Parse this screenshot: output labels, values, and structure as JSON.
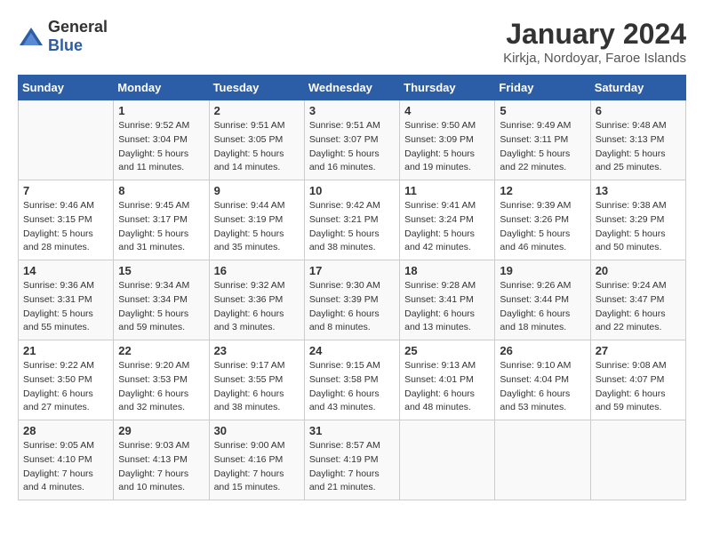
{
  "logo": {
    "general": "General",
    "blue": "Blue"
  },
  "title": "January 2024",
  "location": "Kirkja, Nordoyar, Faroe Islands",
  "weekdays": [
    "Sunday",
    "Monday",
    "Tuesday",
    "Wednesday",
    "Thursday",
    "Friday",
    "Saturday"
  ],
  "weeks": [
    [
      {
        "day": "",
        "sunrise": "",
        "sunset": "",
        "daylight": ""
      },
      {
        "day": "1",
        "sunrise": "Sunrise: 9:52 AM",
        "sunset": "Sunset: 3:04 PM",
        "daylight": "Daylight: 5 hours and 11 minutes."
      },
      {
        "day": "2",
        "sunrise": "Sunrise: 9:51 AM",
        "sunset": "Sunset: 3:05 PM",
        "daylight": "Daylight: 5 hours and 14 minutes."
      },
      {
        "day": "3",
        "sunrise": "Sunrise: 9:51 AM",
        "sunset": "Sunset: 3:07 PM",
        "daylight": "Daylight: 5 hours and 16 minutes."
      },
      {
        "day": "4",
        "sunrise": "Sunrise: 9:50 AM",
        "sunset": "Sunset: 3:09 PM",
        "daylight": "Daylight: 5 hours and 19 minutes."
      },
      {
        "day": "5",
        "sunrise": "Sunrise: 9:49 AM",
        "sunset": "Sunset: 3:11 PM",
        "daylight": "Daylight: 5 hours and 22 minutes."
      },
      {
        "day": "6",
        "sunrise": "Sunrise: 9:48 AM",
        "sunset": "Sunset: 3:13 PM",
        "daylight": "Daylight: 5 hours and 25 minutes."
      }
    ],
    [
      {
        "day": "7",
        "sunrise": "Sunrise: 9:46 AM",
        "sunset": "Sunset: 3:15 PM",
        "daylight": "Daylight: 5 hours and 28 minutes."
      },
      {
        "day": "8",
        "sunrise": "Sunrise: 9:45 AM",
        "sunset": "Sunset: 3:17 PM",
        "daylight": "Daylight: 5 hours and 31 minutes."
      },
      {
        "day": "9",
        "sunrise": "Sunrise: 9:44 AM",
        "sunset": "Sunset: 3:19 PM",
        "daylight": "Daylight: 5 hours and 35 minutes."
      },
      {
        "day": "10",
        "sunrise": "Sunrise: 9:42 AM",
        "sunset": "Sunset: 3:21 PM",
        "daylight": "Daylight: 5 hours and 38 minutes."
      },
      {
        "day": "11",
        "sunrise": "Sunrise: 9:41 AM",
        "sunset": "Sunset: 3:24 PM",
        "daylight": "Daylight: 5 hours and 42 minutes."
      },
      {
        "day": "12",
        "sunrise": "Sunrise: 9:39 AM",
        "sunset": "Sunset: 3:26 PM",
        "daylight": "Daylight: 5 hours and 46 minutes."
      },
      {
        "day": "13",
        "sunrise": "Sunrise: 9:38 AM",
        "sunset": "Sunset: 3:29 PM",
        "daylight": "Daylight: 5 hours and 50 minutes."
      }
    ],
    [
      {
        "day": "14",
        "sunrise": "Sunrise: 9:36 AM",
        "sunset": "Sunset: 3:31 PM",
        "daylight": "Daylight: 5 hours and 55 minutes."
      },
      {
        "day": "15",
        "sunrise": "Sunrise: 9:34 AM",
        "sunset": "Sunset: 3:34 PM",
        "daylight": "Daylight: 5 hours and 59 minutes."
      },
      {
        "day": "16",
        "sunrise": "Sunrise: 9:32 AM",
        "sunset": "Sunset: 3:36 PM",
        "daylight": "Daylight: 6 hours and 3 minutes."
      },
      {
        "day": "17",
        "sunrise": "Sunrise: 9:30 AM",
        "sunset": "Sunset: 3:39 PM",
        "daylight": "Daylight: 6 hours and 8 minutes."
      },
      {
        "day": "18",
        "sunrise": "Sunrise: 9:28 AM",
        "sunset": "Sunset: 3:41 PM",
        "daylight": "Daylight: 6 hours and 13 minutes."
      },
      {
        "day": "19",
        "sunrise": "Sunrise: 9:26 AM",
        "sunset": "Sunset: 3:44 PM",
        "daylight": "Daylight: 6 hours and 18 minutes."
      },
      {
        "day": "20",
        "sunrise": "Sunrise: 9:24 AM",
        "sunset": "Sunset: 3:47 PM",
        "daylight": "Daylight: 6 hours and 22 minutes."
      }
    ],
    [
      {
        "day": "21",
        "sunrise": "Sunrise: 9:22 AM",
        "sunset": "Sunset: 3:50 PM",
        "daylight": "Daylight: 6 hours and 27 minutes."
      },
      {
        "day": "22",
        "sunrise": "Sunrise: 9:20 AM",
        "sunset": "Sunset: 3:53 PM",
        "daylight": "Daylight: 6 hours and 32 minutes."
      },
      {
        "day": "23",
        "sunrise": "Sunrise: 9:17 AM",
        "sunset": "Sunset: 3:55 PM",
        "daylight": "Daylight: 6 hours and 38 minutes."
      },
      {
        "day": "24",
        "sunrise": "Sunrise: 9:15 AM",
        "sunset": "Sunset: 3:58 PM",
        "daylight": "Daylight: 6 hours and 43 minutes."
      },
      {
        "day": "25",
        "sunrise": "Sunrise: 9:13 AM",
        "sunset": "Sunset: 4:01 PM",
        "daylight": "Daylight: 6 hours and 48 minutes."
      },
      {
        "day": "26",
        "sunrise": "Sunrise: 9:10 AM",
        "sunset": "Sunset: 4:04 PM",
        "daylight": "Daylight: 6 hours and 53 minutes."
      },
      {
        "day": "27",
        "sunrise": "Sunrise: 9:08 AM",
        "sunset": "Sunset: 4:07 PM",
        "daylight": "Daylight: 6 hours and 59 minutes."
      }
    ],
    [
      {
        "day": "28",
        "sunrise": "Sunrise: 9:05 AM",
        "sunset": "Sunset: 4:10 PM",
        "daylight": "Daylight: 7 hours and 4 minutes."
      },
      {
        "day": "29",
        "sunrise": "Sunrise: 9:03 AM",
        "sunset": "Sunset: 4:13 PM",
        "daylight": "Daylight: 7 hours and 10 minutes."
      },
      {
        "day": "30",
        "sunrise": "Sunrise: 9:00 AM",
        "sunset": "Sunset: 4:16 PM",
        "daylight": "Daylight: 7 hours and 15 minutes."
      },
      {
        "day": "31",
        "sunrise": "Sunrise: 8:57 AM",
        "sunset": "Sunset: 4:19 PM",
        "daylight": "Daylight: 7 hours and 21 minutes."
      },
      {
        "day": "",
        "sunrise": "",
        "sunset": "",
        "daylight": ""
      },
      {
        "day": "",
        "sunrise": "",
        "sunset": "",
        "daylight": ""
      },
      {
        "day": "",
        "sunrise": "",
        "sunset": "",
        "daylight": ""
      }
    ]
  ]
}
